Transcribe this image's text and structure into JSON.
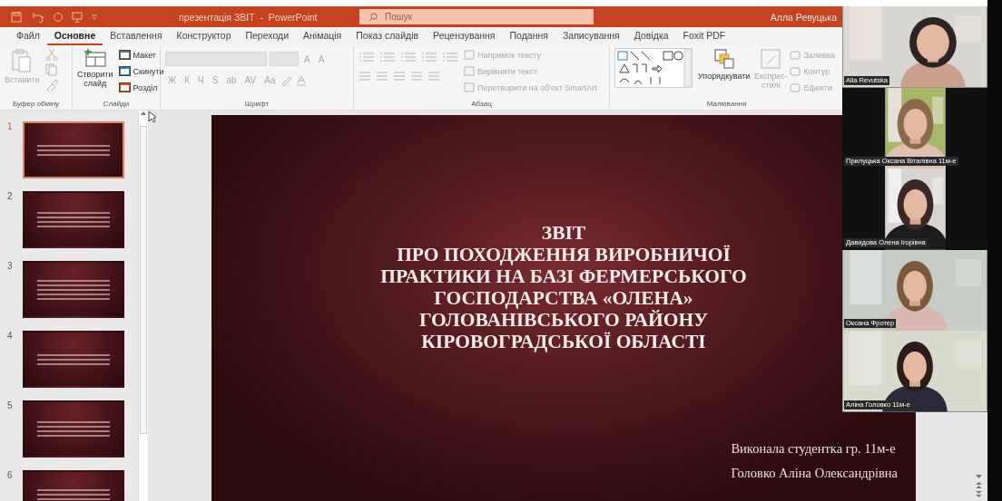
{
  "title_bar": {
    "title": "презентація ЗВІТ  -  PowerPoint",
    "search": {
      "placeholder": "Пошук"
    },
    "user": "Алла Ревуцька"
  },
  "tabs": [
    {
      "label": "Файл",
      "selected": false
    },
    {
      "label": "Основне",
      "selected": true
    },
    {
      "label": "Вставлення",
      "selected": false
    },
    {
      "label": "Конструктор",
      "selected": false
    },
    {
      "label": "Переходи",
      "selected": false
    },
    {
      "label": "Анімація",
      "selected": false
    },
    {
      "label": "Показ слайдів",
      "selected": false
    },
    {
      "label": "Рецензування",
      "selected": false
    },
    {
      "label": "Подання",
      "selected": false
    },
    {
      "label": "Записування",
      "selected": false
    },
    {
      "label": "Довідка",
      "selected": false
    },
    {
      "label": "Foxit PDF",
      "selected": false
    }
  ],
  "ribbon": {
    "groups": [
      {
        "kind": "clipboard",
        "label": "Буфер обміну",
        "buttons": [
          {
            "label": "Вставити",
            "disabled": true
          }
        ]
      },
      {
        "kind": "slides",
        "label": "Слайди",
        "buttons": [
          {
            "label": "Створити слайд",
            "disabled": false
          },
          {
            "label": "Макет",
            "disabled": false
          },
          {
            "label": "Скинути",
            "disabled": false
          },
          {
            "label": "Розділ",
            "disabled": false
          }
        ]
      },
      {
        "kind": "font",
        "label": "Шрифт",
        "glyphs": [
          {
            "label": "A",
            "disabled": true
          },
          {
            "label": "A",
            "disabled": true
          },
          {
            "label": "Ж",
            "disabled": true
          },
          {
            "label": "К",
            "disabled": true
          },
          {
            "label": "Ч",
            "disabled": true
          },
          {
            "label": "S",
            "disabled": true
          },
          {
            "label": "ab",
            "disabled": true
          },
          {
            "label": "AV",
            "disabled": true
          },
          {
            "label": "Aa",
            "disabled": true
          }
        ]
      },
      {
        "kind": "paragraph",
        "label": "Абзац",
        "buttons": [
          {
            "label": "Напрямок тексту",
            "disabled": true
          },
          {
            "label": "Вирівняти текст",
            "disabled": true
          },
          {
            "label": "Перетворити на об'єкт SmartArt",
            "disabled": true
          }
        ]
      },
      {
        "kind": "drawing",
        "label": "Малювання",
        "buttons": [
          {
            "label": "Упорядкувати",
            "disabled": false
          },
          {
            "label": "Експрес-стилі",
            "disabled": true
          },
          {
            "label": "Заливка",
            "disabled": true
          },
          {
            "label": "Контур",
            "disabled": true
          },
          {
            "label": "Ефекти",
            "disabled": true
          }
        ]
      }
    ]
  },
  "thumbnails": [
    {
      "number": "1",
      "selected": true
    },
    {
      "number": "2",
      "selected": false
    },
    {
      "number": "3",
      "selected": false
    },
    {
      "number": "4",
      "selected": false
    },
    {
      "number": "5",
      "selected": false
    },
    {
      "number": "6",
      "selected": false
    }
  ],
  "slide": {
    "title_lines": [
      "ЗВІТ",
      "ПРО ПОХОДЖЕННЯ ВИРОБНИЧОЇ",
      "ПРАКТИКИ НА БАЗІ ФЕРМЕРСЬКОГО",
      "ГОСПОДАРСТВА «ОЛЕНА»",
      "ГОЛОВАНІВСЬКОГО РАЙОНУ",
      "КІРОВОГРАДСЬКОЇ ОБЛАСТІ"
    ],
    "subtitle_lines": [
      "Виконала студентка гр. 11м-е",
      "Головко Аліна Олександрівна"
    ]
  },
  "participants": [
    {
      "name": "Alla Revutska",
      "kind": "wide"
    },
    {
      "name": "Прилуцька Оксана Віталівна 11м-е",
      "kind": "narrow"
    },
    {
      "name": "Давидова Олена Ігорівна",
      "kind": "narrow"
    },
    {
      "name": "Оксана Фротер",
      "kind": "wide"
    },
    {
      "name": "Аліна Головко 11м-е",
      "kind": "wide"
    }
  ]
}
